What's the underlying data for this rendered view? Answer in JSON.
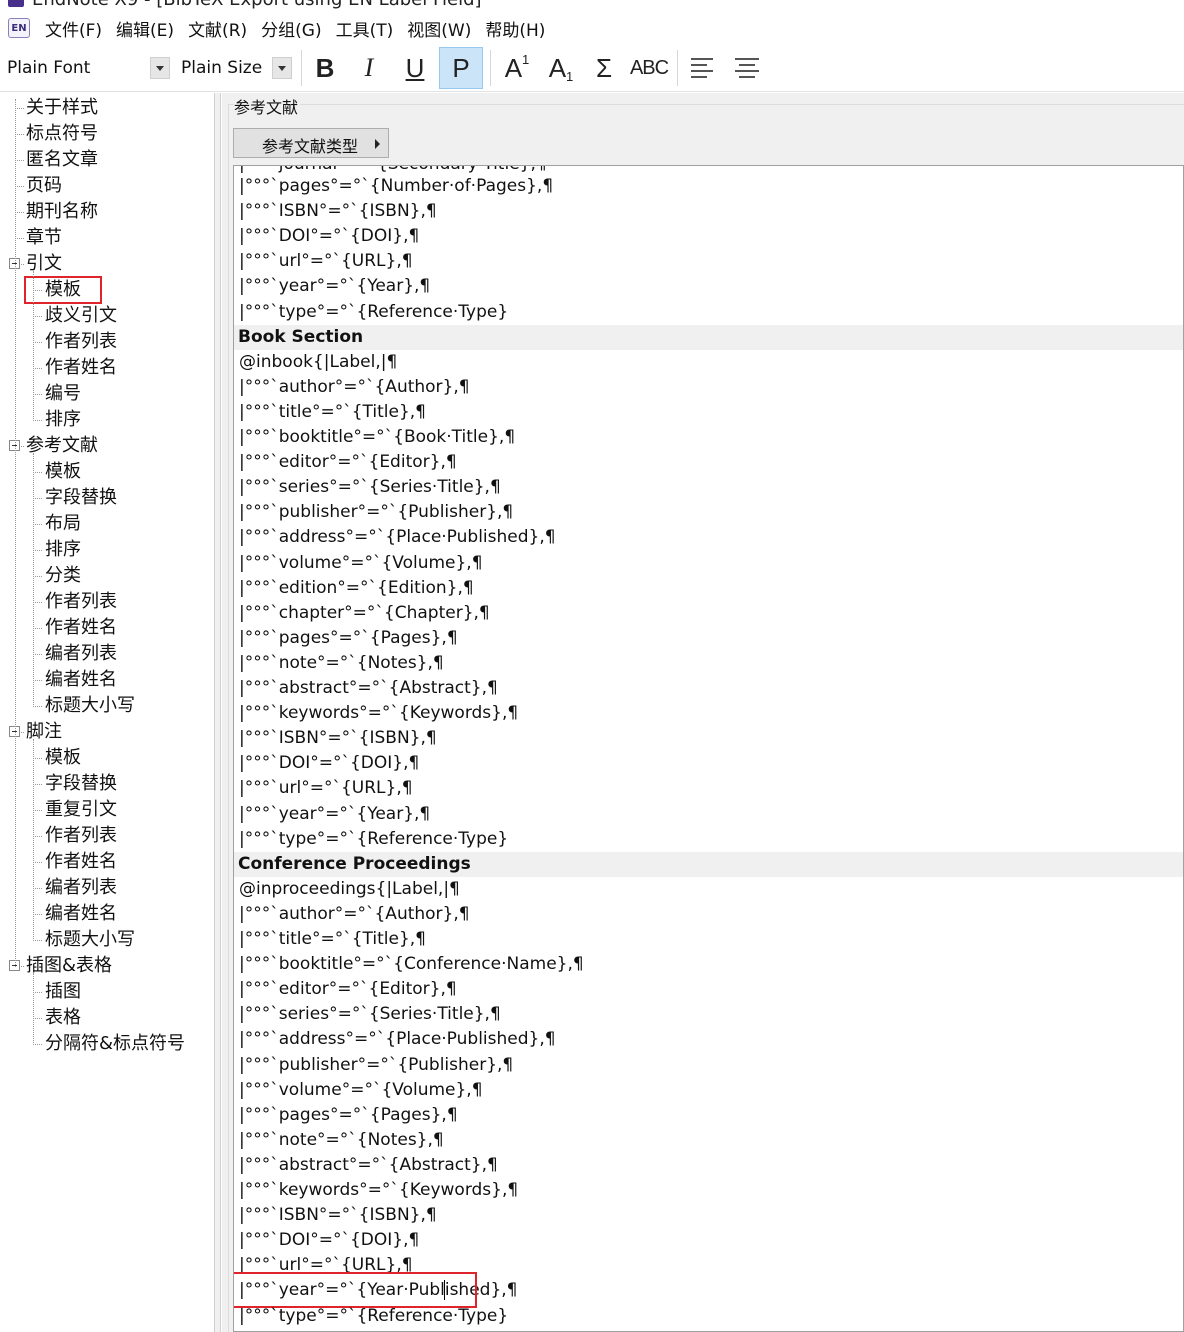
{
  "window": {
    "title": "EndNote X9 - [BibTeX Export using EN Label Field]"
  },
  "menubar": {
    "app_badge": "EN",
    "items": [
      {
        "label": "文件(F)"
      },
      {
        "label": "编辑(E)"
      },
      {
        "label": "文献(R)"
      },
      {
        "label": "分组(G)"
      },
      {
        "label": "工具(T)"
      },
      {
        "label": "视图(W)"
      },
      {
        "label": "帮助(H)"
      }
    ]
  },
  "toolbar": {
    "font_value": "Plain Font",
    "size_value": "Plain Size",
    "bold_label": "B",
    "italic_label": "I",
    "underline_label": "U",
    "plain_label": "P",
    "superscript_base": "A",
    "superscript_mark": "1",
    "subscript_base": "A",
    "subscript_mark": "1",
    "symbol_label": "Σ",
    "smallcaps_label": "ABC",
    "plain_active": true
  },
  "sidebar": {
    "items": [
      {
        "label": "关于样式",
        "level": 0,
        "expandable": false
      },
      {
        "label": "标点符号",
        "level": 0,
        "expandable": false
      },
      {
        "label": "匿名文章",
        "level": 0,
        "expandable": false
      },
      {
        "label": "页码",
        "level": 0,
        "expandable": false
      },
      {
        "label": "期刊名称",
        "level": 0,
        "expandable": false
      },
      {
        "label": "章节",
        "level": 0,
        "expandable": false
      },
      {
        "label": "引文",
        "level": 0,
        "expandable": true
      },
      {
        "label": "模板",
        "level": 1,
        "expandable": false,
        "highlighted": true
      },
      {
        "label": "歧义引文",
        "level": 1,
        "expandable": false
      },
      {
        "label": "作者列表",
        "level": 1,
        "expandable": false
      },
      {
        "label": "作者姓名",
        "level": 1,
        "expandable": false
      },
      {
        "label": "编号",
        "level": 1,
        "expandable": false
      },
      {
        "label": "排序",
        "level": 1,
        "expandable": false
      },
      {
        "label": "参考文献",
        "level": 0,
        "expandable": true
      },
      {
        "label": "模板",
        "level": 1,
        "expandable": false
      },
      {
        "label": "字段替换",
        "level": 1,
        "expandable": false
      },
      {
        "label": "布局",
        "level": 1,
        "expandable": false
      },
      {
        "label": "排序",
        "level": 1,
        "expandable": false
      },
      {
        "label": "分类",
        "level": 1,
        "expandable": false
      },
      {
        "label": "作者列表",
        "level": 1,
        "expandable": false
      },
      {
        "label": "作者姓名",
        "level": 1,
        "expandable": false
      },
      {
        "label": "编者列表",
        "level": 1,
        "expandable": false
      },
      {
        "label": "编者姓名",
        "level": 1,
        "expandable": false
      },
      {
        "label": "标题大小写",
        "level": 1,
        "expandable": false
      },
      {
        "label": "脚注",
        "level": 0,
        "expandable": true
      },
      {
        "label": "模板",
        "level": 1,
        "expandable": false
      },
      {
        "label": "字段替换",
        "level": 1,
        "expandable": false
      },
      {
        "label": "重复引文",
        "level": 1,
        "expandable": false
      },
      {
        "label": "作者列表",
        "level": 1,
        "expandable": false
      },
      {
        "label": "作者姓名",
        "level": 1,
        "expandable": false
      },
      {
        "label": "编者列表",
        "level": 1,
        "expandable": false
      },
      {
        "label": "编者姓名",
        "level": 1,
        "expandable": false
      },
      {
        "label": "标题大小写",
        "level": 1,
        "expandable": false
      },
      {
        "label": "插图&表格",
        "level": 0,
        "expandable": true
      },
      {
        "label": "插图",
        "level": 1,
        "expandable": false
      },
      {
        "label": "表格",
        "level": 1,
        "expandable": false
      },
      {
        "label": "分隔符&标点符号",
        "level": 1,
        "expandable": false
      }
    ]
  },
  "panel": {
    "group_label": "参考文献",
    "reftype_button": "参考文献类型"
  },
  "editor": {
    "lines": [
      {
        "kind": "code",
        "text": "|°°°`pages°=°`{Number·of·Pages},¶"
      },
      {
        "kind": "code",
        "text": "|°°°`ISBN°=°`{ISBN},¶"
      },
      {
        "kind": "code",
        "text": "|°°°`DOI°=°`{DOI},¶"
      },
      {
        "kind": "code",
        "text": "|°°°`url°=°`{URL},¶"
      },
      {
        "kind": "code",
        "text": "|°°°`year°=°`{Year},¶"
      },
      {
        "kind": "code",
        "text": "|°°°`type°=°`{Reference·Type}"
      },
      {
        "kind": "head",
        "text": "Book Section"
      },
      {
        "kind": "code",
        "text": "@inbook{|Label,|¶"
      },
      {
        "kind": "code",
        "text": "|°°°`author°=°`{Author},¶"
      },
      {
        "kind": "code",
        "text": "|°°°`title°=°`{Title},¶"
      },
      {
        "kind": "code",
        "text": "|°°°`booktitle°=°`{Book·Title},¶"
      },
      {
        "kind": "code",
        "text": "|°°°`editor°=°`{Editor},¶"
      },
      {
        "kind": "code",
        "text": "|°°°`series°=°`{Series·Title},¶"
      },
      {
        "kind": "code",
        "text": "|°°°`publisher°=°`{Publisher},¶"
      },
      {
        "kind": "code",
        "text": "|°°°`address°=°`{Place·Published},¶"
      },
      {
        "kind": "code",
        "text": "|°°°`volume°=°`{Volume},¶"
      },
      {
        "kind": "code",
        "text": "|°°°`edition°=°`{Edition},¶"
      },
      {
        "kind": "code",
        "text": "|°°°`chapter°=°`{Chapter},¶"
      },
      {
        "kind": "code",
        "text": "|°°°`pages°=°`{Pages},¶"
      },
      {
        "kind": "code",
        "text": "|°°°`note°=°`{Notes},¶"
      },
      {
        "kind": "code",
        "text": "|°°°`abstract°=°`{Abstract},¶"
      },
      {
        "kind": "code",
        "text": "|°°°`keywords°=°`{Keywords},¶"
      },
      {
        "kind": "code",
        "text": "|°°°`ISBN°=°`{ISBN},¶"
      },
      {
        "kind": "code",
        "text": "|°°°`DOI°=°`{DOI},¶"
      },
      {
        "kind": "code",
        "text": "|°°°`url°=°`{URL},¶"
      },
      {
        "kind": "code",
        "text": "|°°°`year°=°`{Year},¶"
      },
      {
        "kind": "code",
        "text": "|°°°`type°=°`{Reference·Type}"
      },
      {
        "kind": "head",
        "text": "Conference Proceedings"
      },
      {
        "kind": "code",
        "text": "@inproceedings{|Label,|¶"
      },
      {
        "kind": "code",
        "text": "|°°°`author°=°`{Author},¶"
      },
      {
        "kind": "code",
        "text": "|°°°`title°=°`{Title},¶"
      },
      {
        "kind": "code",
        "text": "|°°°`booktitle°=°`{Conference·Name},¶"
      },
      {
        "kind": "code",
        "text": "|°°°`editor°=°`{Editor},¶"
      },
      {
        "kind": "code",
        "text": "|°°°`series°=°`{Series·Title},¶"
      },
      {
        "kind": "code",
        "text": "|°°°`address°=°`{Place·Published},¶"
      },
      {
        "kind": "code",
        "text": "|°°°`publisher°=°`{Publisher},¶"
      },
      {
        "kind": "code",
        "text": "|°°°`volume°=°`{Volume},¶"
      },
      {
        "kind": "code",
        "text": "|°°°`pages°=°`{Pages},¶"
      },
      {
        "kind": "code",
        "text": "|°°°`note°=°`{Notes},¶"
      },
      {
        "kind": "code",
        "text": "|°°°`abstract°=°`{Abstract},¶"
      },
      {
        "kind": "code",
        "text": "|°°°`keywords°=°`{Keywords},¶"
      },
      {
        "kind": "code",
        "text": "|°°°`ISBN°=°`{ISBN},¶"
      },
      {
        "kind": "code",
        "text": "|°°°`DOI°=°`{DOI},¶"
      },
      {
        "kind": "code",
        "text": "|°°°`url°=°`{URL},¶"
      },
      {
        "kind": "code",
        "text": "|°°°`year°=°`{Year·Published},¶",
        "highlighted": true
      },
      {
        "kind": "code",
        "text": "|°°°`type°=°`{Reference·Type}"
      }
    ]
  },
  "colors": {
    "highlight_border": "#e0242b",
    "active_button_bg": "#cce4f7",
    "section_header_bg": "#f0f0f0"
  }
}
